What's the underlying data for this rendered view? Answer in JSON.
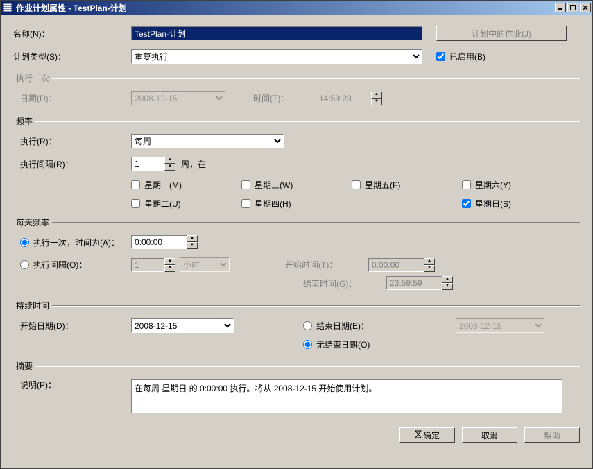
{
  "window": {
    "title": "作业计划属性 - TestPlan-计划"
  },
  "labels": {
    "name": "名称(N)：",
    "schedule_type": "计划类型(S)：",
    "jobs_button": "计划中的作业(J)",
    "enabled": "已启用(B)",
    "group_once": "执行一次",
    "date": "日期(D)：",
    "time": "时间(T)：",
    "group_freq": "频率",
    "execute": "执行(R)：",
    "recur_every": "执行间隔(R)：",
    "week_suffix": "周，在",
    "mon": "星期一(M)",
    "tue": "星期二(U)",
    "wed": "星期三(W)",
    "thu": "星期四(H)",
    "fri": "星期五(F)",
    "sat": "星期六(Y)",
    "sun": "星期日(S)",
    "group_daily": "每天频率",
    "occurs_once": "执行一次，时间为(A)：",
    "occurs_every": "执行间隔(O)：",
    "start_time": "开始时间(T)：",
    "end_time": "结束时间(G)：",
    "group_duration": "持续时间",
    "start_date": "开始日期(D)：",
    "end_date": "结束日期(E)：",
    "no_end_date": "无结束日期(O)",
    "group_summary": "摘要",
    "description": "说明(P)：",
    "ok": "确定",
    "cancel": "取消",
    "help": "帮助"
  },
  "values": {
    "name": "TestPlan-计划",
    "schedule_type": "重复执行",
    "enabled": true,
    "once_date": "2008-12-15",
    "once_time": "14:59:23",
    "execute": "每周",
    "recur_weeks": "1",
    "days": {
      "mon": false,
      "tue": false,
      "wed": false,
      "thu": false,
      "fri": false,
      "sat": false,
      "sun": true
    },
    "daily_mode": "once",
    "once_at": "0:00:00",
    "every_n": "1",
    "every_unit": "小时",
    "daily_start": "0:00:00",
    "daily_end": "23:59:59",
    "start_date": "2008-12-15",
    "end_date_mode": "no_end",
    "end_date": "2008-12-15",
    "description": "在每周 星期日 的 0:00:00 执行。将从 2008-12-15 开始使用计划。"
  }
}
